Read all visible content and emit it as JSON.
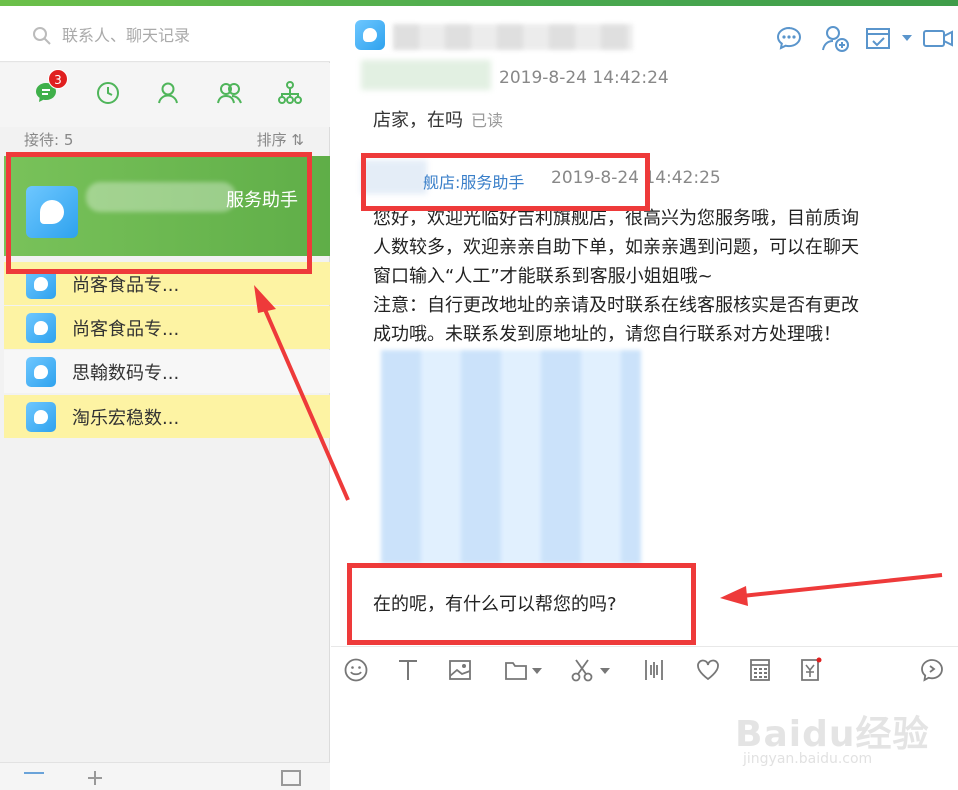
{
  "search": {
    "placeholder": "联系人、聊天记录"
  },
  "nav": {
    "badge": "3"
  },
  "list_header": {
    "reception": "接待: 5",
    "sort": "排序 ⇅"
  },
  "conversations": {
    "active": {
      "name": "服务助手"
    },
    "items": [
      {
        "name": "尚客食品专...",
        "highlight": "yellow"
      },
      {
        "name": "尚客食品专...",
        "highlight": "yellow"
      },
      {
        "name": "思翰数码专...",
        "highlight": "none"
      },
      {
        "name": "淘乐宏稳数...",
        "highlight": "yellow"
      }
    ]
  },
  "chat": {
    "time1": "2019-8-24 14:42:24",
    "msg1": "店家，在吗",
    "msg1_status": "已读",
    "sender": "舰店:服务助手",
    "time2": "2019-8-24 14:42:25",
    "msg2_lines": [
      "您好，欢迎光临好吉利旗舰店，很高兴为您服务哦，目前质询",
      "人数较多，欢迎亲亲自助下单，如亲亲遇到问题，可以在聊天",
      "窗口输入“人工”才能联系到客服小姐姐哦~",
      "注意：自行更改地址的亲请及时联系在线客服核实是否有更改",
      "成功哦。未联系发到原地址的，请您自行联系对方处理哦！"
    ],
    "msg3": "在的呢，有什么可以帮您的吗?"
  },
  "watermark": {
    "main": "Baidu经验",
    "sub": "jingyan.baidu.com"
  },
  "colors": {
    "brand_green": "#5fae48",
    "highlight_yellow": "#fdf3a3",
    "annotation_red": "#ee3a3a",
    "link_blue": "#3a7fc9"
  }
}
